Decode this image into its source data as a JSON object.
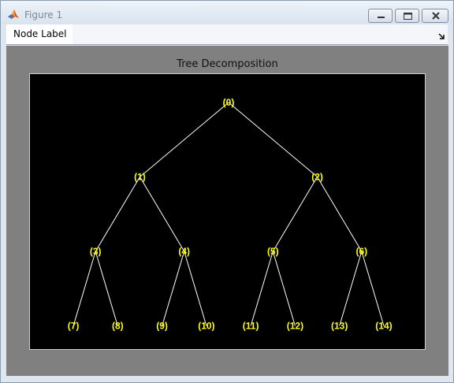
{
  "window": {
    "title": "Figure 1",
    "title_color": "#7b8794",
    "icons": {
      "app": "matlab-icon",
      "minimize": "minimize-icon",
      "maximize": "maximize-icon",
      "close": "close-icon"
    }
  },
  "menubar": {
    "items": [
      {
        "label": "Node Label"
      }
    ],
    "dock_icon": "dock-arrow-icon"
  },
  "figure": {
    "background": "#808080",
    "axes_background": "#000000",
    "title": "Tree Decomposition"
  },
  "tree": {
    "edge_color": "#ffffff",
    "label_color": "#ffff00",
    "nodes": [
      {
        "id": 0,
        "label": "(0)",
        "parent": null
      },
      {
        "id": 1,
        "label": "(1)",
        "parent": 0
      },
      {
        "id": 2,
        "label": "(2)",
        "parent": 0
      },
      {
        "id": 3,
        "label": "(3)",
        "parent": 1
      },
      {
        "id": 4,
        "label": "(4)",
        "parent": 1
      },
      {
        "id": 5,
        "label": "(5)",
        "parent": 2
      },
      {
        "id": 6,
        "label": "(6)",
        "parent": 2
      },
      {
        "id": 7,
        "label": "(7)",
        "parent": 3
      },
      {
        "id": 8,
        "label": "(8)",
        "parent": 3
      },
      {
        "id": 9,
        "label": "(9)",
        "parent": 4
      },
      {
        "id": 10,
        "label": "(10)",
        "parent": 4
      },
      {
        "id": 11,
        "label": "(11)",
        "parent": 5
      },
      {
        "id": 12,
        "label": "(12)",
        "parent": 5
      },
      {
        "id": 13,
        "label": "(13)",
        "parent": 6
      },
      {
        "id": 14,
        "label": "(14)",
        "parent": 6
      }
    ]
  }
}
